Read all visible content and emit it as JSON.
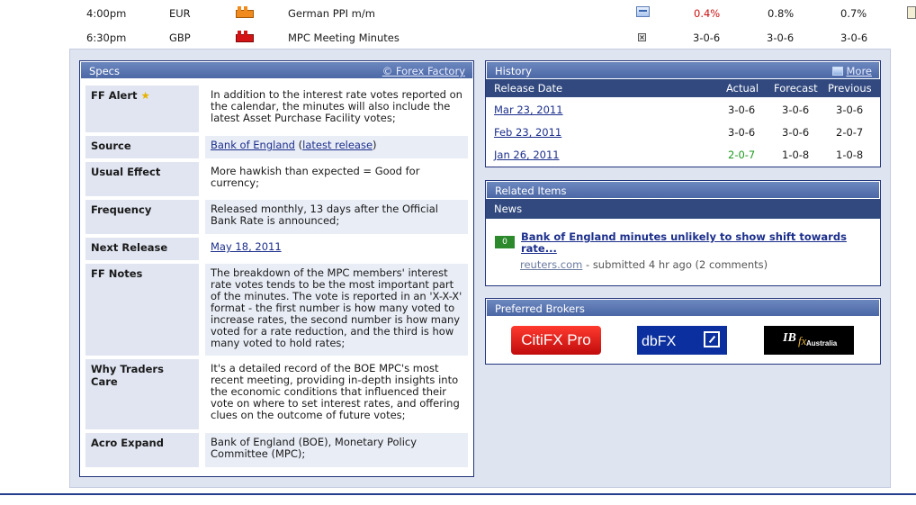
{
  "calendar": {
    "rows": [
      {
        "time": "4:00pm",
        "currency": "EUR",
        "impact_color": "#f08a1c",
        "event": "German PPI m/m",
        "detail_icon": "detail-chart-icon",
        "actual": "0.4%",
        "actual_color": "#cc1111",
        "forecast": "0.8%",
        "previous": "0.7%"
      },
      {
        "time": "6:30pm",
        "currency": "GBP",
        "impact_color": "#d41414",
        "event": "MPC Meeting Minutes",
        "detail_icon": "close-detail-icon",
        "actual": "3-0-6",
        "actual_color": "#1a1a1a",
        "forecast": "3-0-6",
        "previous": "3-0-6"
      }
    ]
  },
  "specs": {
    "title": "Specs",
    "source_link": "© Forex Factory",
    "rows": [
      {
        "label": "FF Alert",
        "value": "In addition to the interest rate votes reported on the calendar, the minutes will also include the latest Asset Purchase Facility votes;"
      },
      {
        "label": "Source",
        "value_link1": "Bank of England",
        "value_link2": "latest release"
      },
      {
        "label": "Usual Effect",
        "value": "More hawkish than expected = Good for currency;"
      },
      {
        "label": "Frequency",
        "value": "Released monthly, 13 days after the Official Bank Rate is announced;"
      },
      {
        "label": "Next Release",
        "value_link": "May 18, 2011"
      },
      {
        "label": "FF Notes",
        "value": "The breakdown of the MPC members' interest rate votes tends to be the most important part of the minutes. The vote is reported in an 'X-X-X' format - the first number is how many voted to increase rates, the second number is how many voted for a rate reduction, and the third is how many voted to hold rates;"
      },
      {
        "label": "Why Traders Care",
        "value": "It's a detailed record of the BOE MPC's most recent meeting, providing in-depth insights into the economic conditions that influenced their vote on where to set interest rates, and offering clues on the outcome of future votes;"
      },
      {
        "label": "Acro Expand",
        "value": "Bank of England (BOE), Monetary Policy Committee (MPC);"
      }
    ]
  },
  "history": {
    "title": "History",
    "more_label": "More",
    "columns": [
      "Release Date",
      "Actual",
      "Forecast",
      "Previous"
    ],
    "rows": [
      {
        "date": "Mar 23, 2011",
        "actual": "3-0-6",
        "actual_color": "#1a1a1a",
        "forecast": "3-0-6",
        "previous": "3-0-6"
      },
      {
        "date": "Feb 23, 2011",
        "actual": "3-0-6",
        "actual_color": "#1a1a1a",
        "forecast": "3-0-6",
        "previous": "2-0-7"
      },
      {
        "date": "Jan 26, 2011",
        "actual": "2-0-7",
        "actual_color": "#1e9a1e",
        "forecast": "1-0-8",
        "previous": "1-0-8"
      }
    ]
  },
  "related": {
    "title": "Related Items",
    "news_tab": "News",
    "item": {
      "badge": "0",
      "headline": "Bank of England minutes unlikely to show shift towards rate...",
      "source": "reuters.com",
      "meta": " - submitted 4 hr ago (2 comments)"
    }
  },
  "brokers": {
    "title": "Preferred Brokers",
    "items": [
      {
        "name": "CitiFX Pro",
        "bg": "#e41d1d"
      },
      {
        "name": "dbFX",
        "bg": "#0b2f9e"
      },
      {
        "name_main": "IB",
        "name_sub": "fx",
        "name_region": "Australia",
        "bg": "#000000"
      }
    ]
  },
  "colors": {
    "panel_border": "#23357c",
    "header_gradient_top": "#6d88bf",
    "column_header": "#31497f",
    "label_bg": "#e0e5f1",
    "link": "#1c2f8c"
  }
}
